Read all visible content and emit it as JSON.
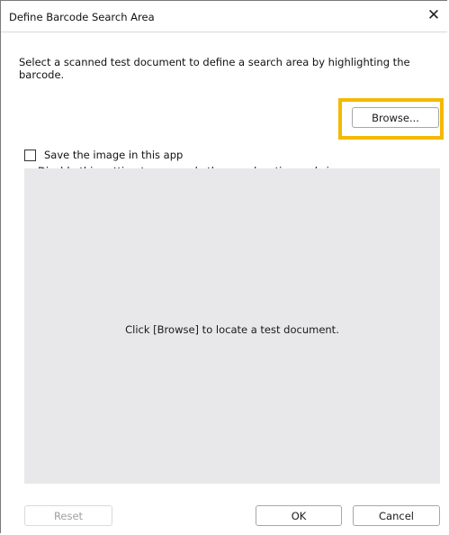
{
  "dialog": {
    "title": "Define Barcode Search Area",
    "close_icon": "close-icon",
    "close_glyph": "✕"
  },
  "instruction": "Select a scanned test document to define a search area by highlighting the barcode.",
  "browse_label": "Browse...",
  "save_image": {
    "label": "Save the image in this app",
    "checked": false
  },
  "hint": "Disable this setting to save only the area location and size.",
  "preview": {
    "placeholder": "Click [Browse] to locate a test document."
  },
  "buttons": {
    "reset": "Reset",
    "ok": "OK",
    "cancel": "Cancel"
  },
  "colors": {
    "highlight": "#f5b800",
    "preview_bg": "#e8e8eb"
  }
}
